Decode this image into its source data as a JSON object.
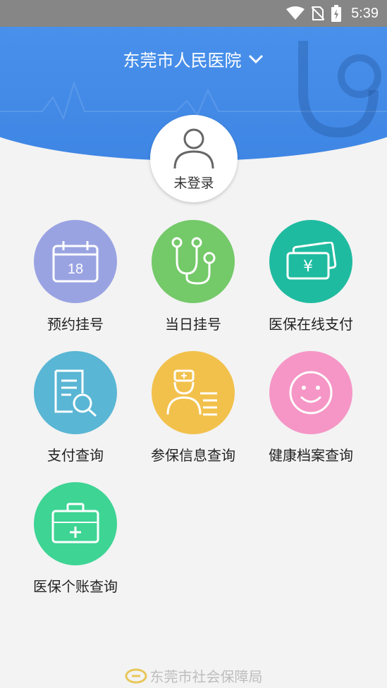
{
  "status_bar": {
    "time": "5:39"
  },
  "header": {
    "title": "东莞市人民医院"
  },
  "avatar": {
    "label": "未登录"
  },
  "menu": [
    {
      "label": "预约挂号",
      "color": "#9aa3e2",
      "icon": "calendar-icon",
      "date": "18"
    },
    {
      "label": "当日挂号",
      "color": "#74c969",
      "icon": "stethoscope-icon"
    },
    {
      "label": "医保在线支付",
      "color": "#1fbba0",
      "icon": "payment-card-icon",
      "symbol": "¥"
    },
    {
      "label": "支付查询",
      "color": "#59b6d4",
      "icon": "document-search-icon"
    },
    {
      "label": "参保信息查询",
      "color": "#f2c14c",
      "icon": "doctor-info-icon"
    },
    {
      "label": "健康档案查询",
      "color": "#f596c6",
      "icon": "smiley-icon"
    },
    {
      "label": "医保个账查询",
      "color": "#3ed494",
      "icon": "medical-kit-icon"
    }
  ],
  "footer": {
    "text": "东莞市社会保障局"
  }
}
